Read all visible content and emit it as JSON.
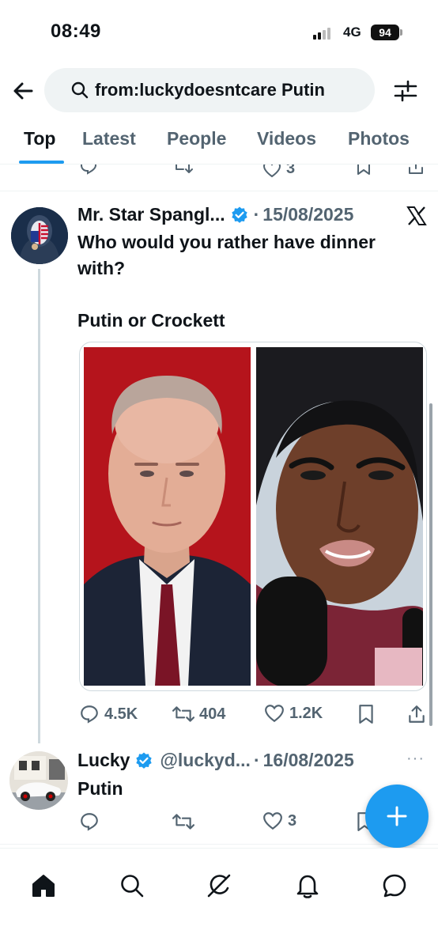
{
  "status_bar": {
    "time": "08:49",
    "network": "4G",
    "battery": "94"
  },
  "search": {
    "query": "from:luckydoesntcare Putin"
  },
  "tabs": [
    {
      "label": "Top"
    },
    {
      "label": "Latest"
    },
    {
      "label": "People"
    },
    {
      "label": "Videos"
    },
    {
      "label": "Photos"
    }
  ],
  "previous_tweet": {
    "likes": "3"
  },
  "tweet1": {
    "author": "Mr. Star Spangl...",
    "separator": "·",
    "date": "15/08/2025",
    "text_line1": "Who would you rather have dinner with?",
    "text_line2": "Putin or Crockett",
    "replies": "4.5K",
    "retweets": "404",
    "likes": "1.2K"
  },
  "tweet2": {
    "author": "Lucky",
    "handle": "@luckyd...",
    "separator": "·",
    "date": "16/08/2025",
    "more": "···",
    "text": "Putin",
    "likes": "3"
  },
  "colors": {
    "accent": "#1d9bf0",
    "text": "#0f1419",
    "secondary": "#536471"
  },
  "icons": [
    "back-arrow-icon",
    "search-icon",
    "filter-icon",
    "reply-icon",
    "retweet-icon",
    "like-icon",
    "bookmark-icon",
    "share-icon",
    "verified-icon",
    "x-logo-icon",
    "compose-icon",
    "home-icon",
    "explore-icon",
    "grok-icon",
    "notifications-icon",
    "messages-icon"
  ]
}
